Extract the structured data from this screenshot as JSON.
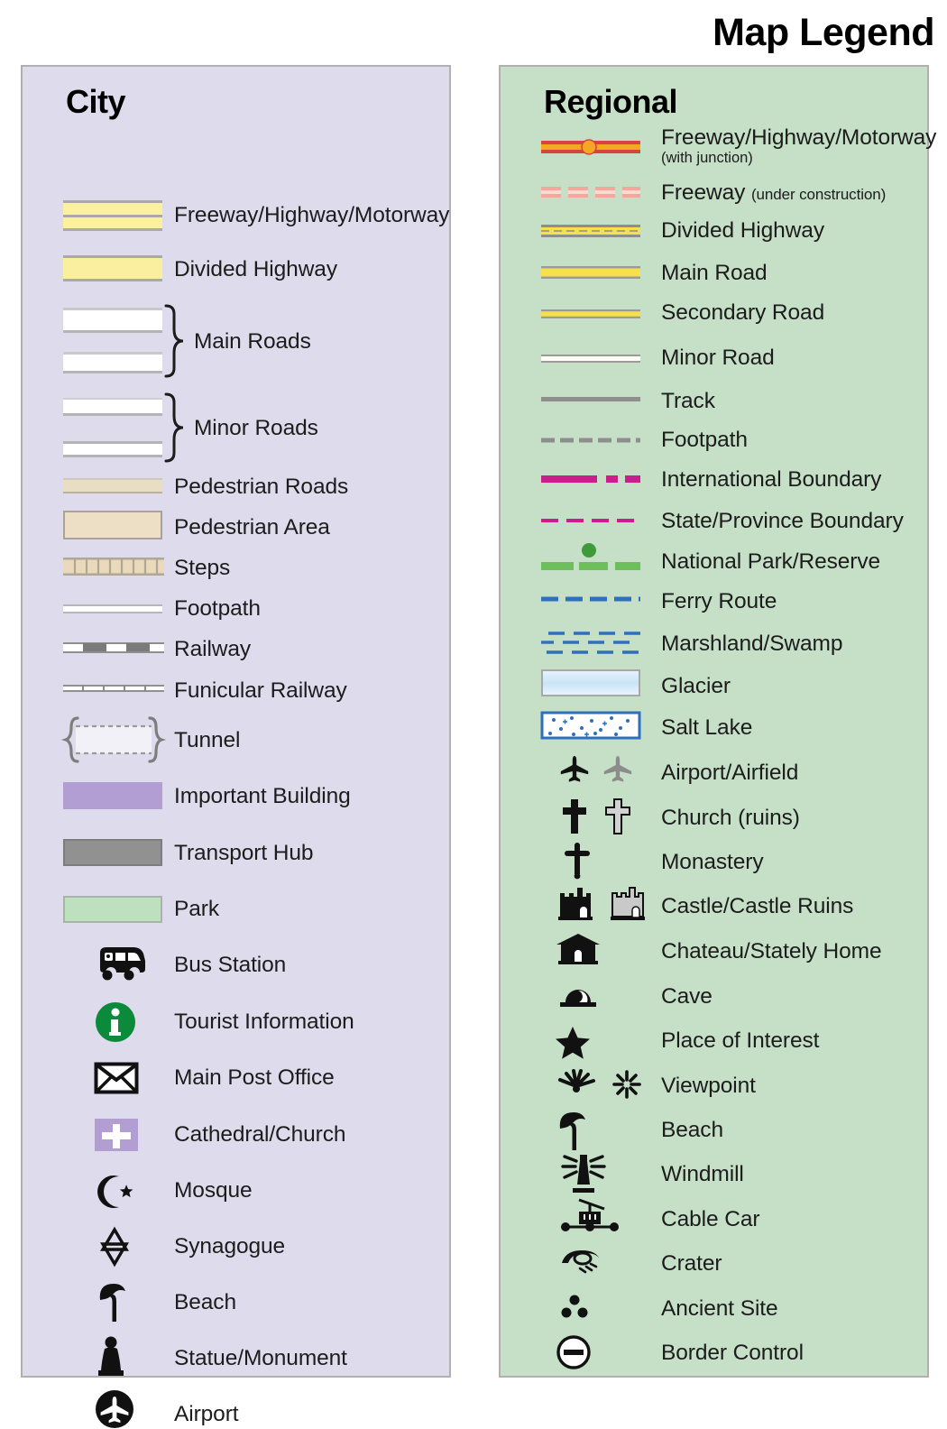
{
  "title": "Map Legend",
  "panels": {
    "city": {
      "heading": "City",
      "background": "#dedcec",
      "items": [
        {
          "label": "Freeway/Highway/Motorway",
          "icon": "freeway-band-icon"
        },
        {
          "label": "Divided Highway",
          "icon": "divided-highway-band-icon"
        },
        {
          "label": "Main Roads",
          "icon": "main-roads-band-icon"
        },
        {
          "label": "Minor Roads",
          "icon": "minor-roads-band-icon"
        },
        {
          "label": "Pedestrian Roads",
          "icon": "pedestrian-road-band-icon"
        },
        {
          "label": "Pedestrian Area",
          "icon": "pedestrian-area-swatch-icon"
        },
        {
          "label": "Steps",
          "icon": "steps-band-icon"
        },
        {
          "label": "Footpath",
          "icon": "footpath-line-icon"
        },
        {
          "label": "Railway",
          "icon": "railway-line-icon"
        },
        {
          "label": "Funicular Railway",
          "icon": "funicular-railway-line-icon"
        },
        {
          "label": "Tunnel",
          "icon": "tunnel-bracket-icon"
        },
        {
          "label": "Important Building",
          "icon": "important-building-swatch-icon"
        },
        {
          "label": "Transport Hub",
          "icon": "transport-hub-swatch-icon"
        },
        {
          "label": "Park",
          "icon": "park-swatch-icon"
        },
        {
          "label": "Bus Station",
          "icon": "bus-icon"
        },
        {
          "label": "Tourist Information",
          "icon": "information-circle-icon"
        },
        {
          "label": "Main Post Office",
          "icon": "envelope-icon"
        },
        {
          "label": "Cathedral/Church",
          "icon": "church-cross-block-icon"
        },
        {
          "label": "Mosque",
          "icon": "crescent-star-icon"
        },
        {
          "label": "Synagogue",
          "icon": "star-of-david-icon"
        },
        {
          "label": "Beach",
          "icon": "parasol-icon"
        },
        {
          "label": "Statue/Monument",
          "icon": "statue-icon"
        },
        {
          "label": "Airport",
          "icon": "airport-circle-icon"
        }
      ]
    },
    "regional": {
      "heading": "Regional",
      "background": "#c6e0c8",
      "items": [
        {
          "label": "Freeway/Highway/Motorway",
          "sublabel": "(with junction)",
          "icon": "freeway-junction-line-icon"
        },
        {
          "label": "Freeway",
          "inline_sublabel": "(under construction)",
          "icon": "freeway-construction-dash-icon"
        },
        {
          "label": "Divided Highway",
          "icon": "divided-highway-line-icon"
        },
        {
          "label": "Main Road",
          "icon": "main-road-line-icon"
        },
        {
          "label": "Secondary Road",
          "icon": "secondary-road-line-icon"
        },
        {
          "label": "Minor Road",
          "icon": "minor-road-line-icon"
        },
        {
          "label": "Track",
          "icon": "track-line-icon"
        },
        {
          "label": "Footpath",
          "icon": "footpath-dash-icon"
        },
        {
          "label": "International Boundary",
          "icon": "international-boundary-icon"
        },
        {
          "label": "State/Province Boundary",
          "icon": "state-boundary-icon"
        },
        {
          "label": "National Park/Reserve",
          "icon": "national-park-icon"
        },
        {
          "label": "Ferry Route",
          "icon": "ferry-route-dash-icon"
        },
        {
          "label": "Marshland/Swamp",
          "icon": "marshland-icon"
        },
        {
          "label": "Glacier",
          "icon": "glacier-swatch-icon"
        },
        {
          "label": "Salt Lake",
          "icon": "salt-lake-swatch-icon"
        },
        {
          "label": "Airport/Airfield",
          "icon": "airplane-pair-icon"
        },
        {
          "label": "Church (ruins)",
          "icon": "cross-pair-icon"
        },
        {
          "label": "Monastery",
          "icon": "monastery-cross-icon"
        },
        {
          "label": "Castle/Castle Ruins",
          "icon": "castle-pair-icon"
        },
        {
          "label": "Chateau/Stately Home",
          "icon": "chateau-icon"
        },
        {
          "label": "Cave",
          "icon": "cave-icon"
        },
        {
          "label": "Place of Interest",
          "icon": "star-icon"
        },
        {
          "label": "Viewpoint",
          "icon": "viewpoint-burst-icon"
        },
        {
          "label": "Beach",
          "icon": "parasol-icon"
        },
        {
          "label": "Windmill",
          "icon": "windmill-icon"
        },
        {
          "label": "Cable Car",
          "icon": "cable-car-icon"
        },
        {
          "label": "Crater",
          "icon": "crater-icon"
        },
        {
          "label": "Ancient Site",
          "icon": "ancient-site-dots-icon"
        },
        {
          "label": "Border Control",
          "icon": "border-control-icon"
        }
      ]
    }
  },
  "colors": {
    "city_panel_bg": "#dedcec",
    "regional_panel_bg": "#c6e0c8",
    "highway_yellow": "#faef9e",
    "road_yellow": "#f7e14a",
    "freeway_red": "#d9433f",
    "freeway_orange": "#f5a623",
    "pedestrian_tan": "#ecdfc6",
    "important_building_purple": "#b29ed2",
    "transport_hub_gray": "#919191",
    "park_green": "#bde0bf",
    "boundary_magenta": "#cc1d8d",
    "ferry_blue": "#2f6fbb",
    "national_park_green": "#6cbf5a",
    "info_green": "#0b8a3c",
    "panel_border": "#b0b0b0"
  }
}
